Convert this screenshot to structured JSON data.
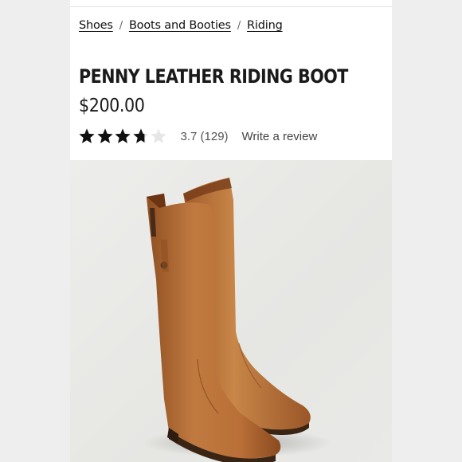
{
  "breadcrumb": {
    "items": [
      {
        "label": "Shoes"
      },
      {
        "label": "Boots and Booties"
      },
      {
        "label": "Riding"
      }
    ],
    "separator": "/"
  },
  "product": {
    "title": "PENNY LEATHER RIDING BOOT",
    "price": "$200.00",
    "rating": {
      "value": 3.7,
      "count_text": "3.7 (129)",
      "max_stars": 5
    },
    "write_review_label": "Write a review"
  },
  "colors": {
    "background": "#eeeeee",
    "card": "#ffffff",
    "text": "#1a1a1a",
    "star_filled": "#111111",
    "star_empty": "#e6e6e6",
    "boot_leather": "#b8703a"
  },
  "icons": {
    "star": "star-icon"
  }
}
